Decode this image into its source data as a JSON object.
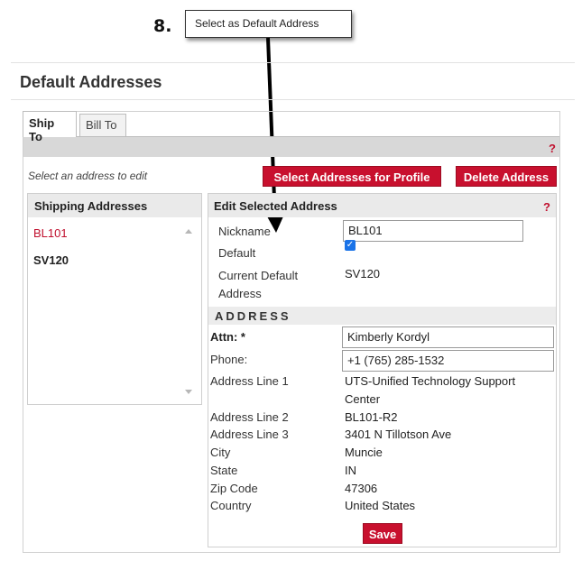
{
  "callout": {
    "step": "8.",
    "text": "Select as Default Address"
  },
  "section_title": "Default Addresses",
  "tabs": [
    {
      "label": "Ship To",
      "active": true
    },
    {
      "label": "Bill To",
      "active": false
    }
  ],
  "help_mark": "?",
  "hint": "Select an address to edit",
  "buttons": {
    "select_profile": "Select Addresses for Profile",
    "delete": "Delete Address",
    "save": "Save"
  },
  "shipping": {
    "header": "Shipping Addresses",
    "items": [
      {
        "label": "BL101",
        "selected": true
      },
      {
        "label": "SV120",
        "selected": false
      }
    ]
  },
  "edit": {
    "header": "Edit Selected Address",
    "nickname_label": "Nickname",
    "nickname_value": "BL101",
    "default_label": "Default",
    "default_checked": true,
    "current_default_label_1": "Current Default",
    "current_default_label_2": "Address",
    "current_default_value": "SV120",
    "address_band": "ADDRESS",
    "fields": {
      "attn_label": "Attn: *",
      "attn_value": "Kimberly Kordyl",
      "phone_label": "Phone:",
      "phone_value": "+1 (765) 285-1532",
      "line1_label": "Address Line 1",
      "line1_value_1": "UTS-Unified Technology Support",
      "line1_value_2": "Center",
      "line2_label": "Address Line 2",
      "line2_value": "BL101-R2",
      "line3_label": "Address Line 3",
      "line3_value": "3401 N Tillotson Ave",
      "city_label": "City",
      "city_value": "Muncie",
      "state_label": "State",
      "state_value": "IN",
      "zip_label": "Zip Code",
      "zip_value": "47306",
      "country_label": "Country",
      "country_value": "United States"
    }
  },
  "colors": {
    "accent_red": "#c8102e",
    "header_gray": "#eaeaea",
    "bar_gray": "#d8d8d8",
    "link_red": "#c0102e"
  }
}
